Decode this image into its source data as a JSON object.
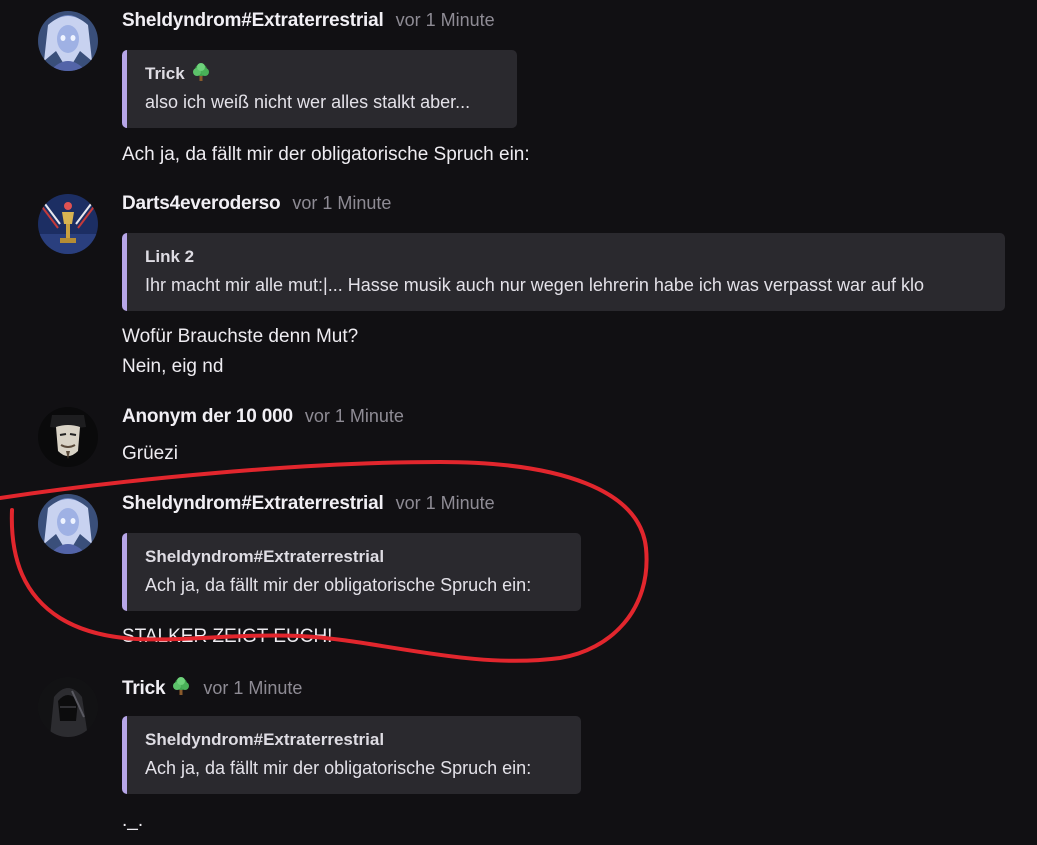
{
  "colors": {
    "background": "#111013",
    "quote_background": "#2a292e",
    "quote_bar": "#b7a6e8",
    "timestamp": "#8e8b94",
    "annotation": "#e2262d"
  },
  "messages": [
    {
      "author": "Sheldyndrom#Extraterrestrial",
      "time": "vor 1 Minute",
      "avatar": "alien-girl-avatar",
      "quote": {
        "author": "Trick",
        "author_icon": "tree-emoji-icon",
        "text": "also ich weiß nicht wer alles stalkt aber..."
      },
      "lines": [
        "Ach ja, da fällt mir der obligatorische Spruch ein:"
      ]
    },
    {
      "author": "Darts4everoderso",
      "time": "vor 1 Minute",
      "avatar": "darts-trophy-avatar",
      "quote": {
        "author": "Link 2",
        "text": "Ihr macht mir alle mut:|... Hasse musik auch nur wegen lehrerin habe ich was verpasst war auf klo"
      },
      "lines": [
        "Wofür Brauchste denn Mut?",
        "Nein, eig nd"
      ]
    },
    {
      "author": "Anonym der 10 000",
      "time": "vor 1 Minute",
      "avatar": "guy-fawkes-mask-avatar",
      "lines": [
        "Grüezi"
      ]
    },
    {
      "author": "Sheldyndrom#Extraterrestrial",
      "time": "vor 1 Minute",
      "avatar": "alien-girl-avatar",
      "quote": {
        "author": "Sheldyndrom#Extraterrestrial",
        "text": "Ach ja, da fällt mir der obligatorische Spruch ein:"
      },
      "lines": [
        "STALKER ZEIGT EUCH!"
      ]
    },
    {
      "author": "Trick",
      "author_icon": "tree-emoji-icon",
      "time": "vor 1 Minute",
      "avatar": "hooded-figure-avatar",
      "quote": {
        "author": "Sheldyndrom#Extraterrestrial",
        "text": "Ach ja, da fällt mir der obligatorische Spruch ein:"
      },
      "lines": [
        "._."
      ]
    }
  ]
}
